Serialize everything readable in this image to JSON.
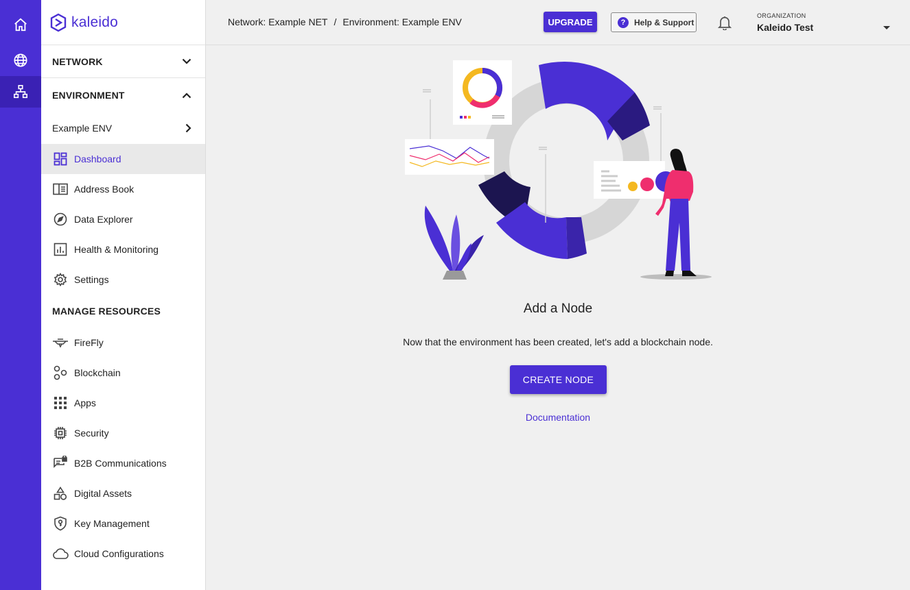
{
  "brand": {
    "name": "kaleido",
    "accent": "#4a2fd4"
  },
  "rail": {
    "items": [
      {
        "icon": "home-icon"
      },
      {
        "icon": "globe-icon"
      },
      {
        "icon": "network-icon"
      }
    ]
  },
  "sidebar": {
    "network_label": "NETWORK",
    "environment_label": "ENVIRONMENT",
    "env_name": "Example ENV",
    "env_items": [
      {
        "label": "Dashboard",
        "icon": "dashboard-icon",
        "active": true
      },
      {
        "label": "Address Book",
        "icon": "address-book-icon"
      },
      {
        "label": "Data Explorer",
        "icon": "compass-icon"
      },
      {
        "label": "Health & Monitoring",
        "icon": "bar-chart-icon"
      },
      {
        "label": "Settings",
        "icon": "gear-icon"
      }
    ],
    "manage_label": "MANAGE RESOURCES",
    "manage_items": [
      {
        "label": "FireFly",
        "icon": "firefly-icon"
      },
      {
        "label": "Blockchain",
        "icon": "blockchain-icon"
      },
      {
        "label": "Apps",
        "icon": "apps-grid-icon"
      },
      {
        "label": "Security",
        "icon": "chip-icon"
      },
      {
        "label": "B2B Communications",
        "icon": "chat-lock-icon"
      },
      {
        "label": "Digital Assets",
        "icon": "shapes-icon"
      },
      {
        "label": "Key Management",
        "icon": "shield-key-icon"
      },
      {
        "label": "Cloud Configurations",
        "icon": "cloud-icon"
      }
    ]
  },
  "topbar": {
    "network_crumb": "Network: Example NET",
    "separator": "/",
    "environment_crumb": "Environment: Example ENV",
    "upgrade_label": "UPGRADE",
    "help_label": "Help & Support",
    "help_glyph": "?",
    "org_label": "ORGANIZATION",
    "org_name": "Kaleido Test"
  },
  "main": {
    "title": "Add a Node",
    "description": "Now that the environment has been created, let's add a blockchain node.",
    "create_label": "CREATE NODE",
    "doc_label": "Documentation"
  }
}
